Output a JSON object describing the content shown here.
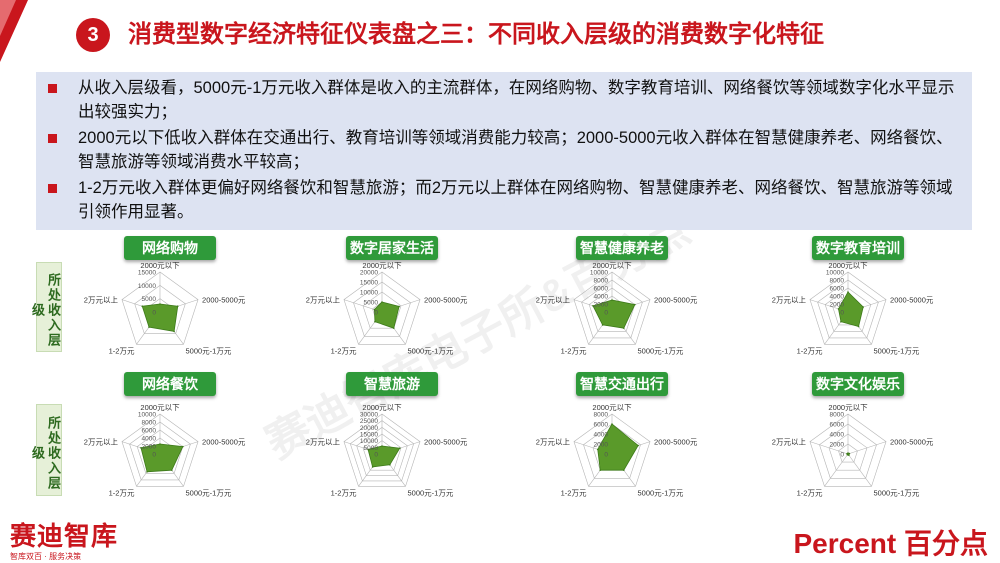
{
  "title": {
    "number": "3",
    "text": "消费型数字经济特征仪表盘之三：不同收入层级的消费数字化特征"
  },
  "bullets": [
    "从收入层级看，5000元-1万元收入群体是收入的主流群体，在网络购物、数字教育培训、网络餐饮等领域数字化水平显示出较强实力；",
    "2000元以下低收入群体在交通出行、教育培训等领域消费能力较高；2000-5000元收入群体在智慧健康养老、网络餐饮、智慧旅游等领域消费水平较高；",
    "1-2万元收入群体更偏好网络餐饮和智慧旅游；而2万元以上群体在网络购物、智慧健康养老、网络餐饮、智慧旅游等领域引领作用显著。"
  ],
  "side_label": "所处收入层级",
  "axes": [
    "2000元以下",
    "2000-5000元",
    "5000元-1万元",
    "1-2万元",
    "2万元以上"
  ],
  "chart_data": [
    {
      "type": "radar",
      "title": "网络购物",
      "ticks": [
        "0",
        "5000",
        "10000",
        "15000"
      ],
      "max": 15000,
      "categories": [
        "2000元以下",
        "2000-5000元",
        "5000元-1万元",
        "1-2万元",
        "2万元以上"
      ],
      "values": [
        3000,
        7000,
        9000,
        7000,
        7000
      ],
      "color": "#5a9a2a"
    },
    {
      "type": "radar",
      "title": "数字居家生活",
      "ticks": [
        "0",
        "5000",
        "10000",
        "15000",
        "20000"
      ],
      "max": 20000,
      "categories": [
        "2000元以下",
        "2000-5000元",
        "5000元-1万元",
        "1-2万元",
        "2万元以上"
      ],
      "values": [
        5000,
        9000,
        10000,
        6000,
        4000
      ],
      "color": "#5a9a2a"
    },
    {
      "type": "radar",
      "title": "智慧健康养老",
      "ticks": [
        "0",
        "2000",
        "4000",
        "6000",
        "8000",
        "10000"
      ],
      "max": 10000,
      "categories": [
        "2000元以下",
        "2000-5000元",
        "5000元-1万元",
        "1-2万元",
        "2万元以上"
      ],
      "values": [
        3000,
        6000,
        5000,
        4000,
        5000
      ],
      "color": "#5a9a2a"
    },
    {
      "type": "radar",
      "title": "数字教育培训",
      "ticks": [
        "0",
        "2000",
        "4000",
        "6000",
        "8000",
        "10000"
      ],
      "max": 10000,
      "categories": [
        "2000元以下",
        "2000-5000元",
        "5000元-1万元",
        "1-2万元",
        "2万元以上"
      ],
      "values": [
        5000,
        4000,
        4500,
        3000,
        2500
      ],
      "color": "#5a9a2a"
    },
    {
      "type": "radar",
      "title": "网络餐饮",
      "ticks": [
        "0",
        "2000",
        "4000",
        "6000",
        "8000",
        "10000"
      ],
      "max": 10000,
      "categories": [
        "2000元以下",
        "2000-5000元",
        "5000元-1万元",
        "1-2万元",
        "2万元以上"
      ],
      "values": [
        2500,
        6000,
        5000,
        5500,
        5000
      ],
      "color": "#5a9a2a"
    },
    {
      "type": "radar",
      "title": "智慧旅游",
      "ticks": [
        "0",
        "5000",
        "10000",
        "15000",
        "20000",
        "25000",
        "30000"
      ],
      "max": 30000,
      "categories": [
        "2000元以下",
        "2000-5000元",
        "5000元-1万元",
        "1-2万元",
        "2万元以上"
      ],
      "values": [
        6000,
        14000,
        10000,
        12000,
        11000
      ],
      "color": "#5a9a2a"
    },
    {
      "type": "radar",
      "title": "智慧交通出行",
      "ticks": [
        "0",
        "2000",
        "4000",
        "6000",
        "8000"
      ],
      "max": 8000,
      "categories": [
        "2000元以下",
        "2000-5000元",
        "5000元-1万元",
        "1-2万元",
        "2万元以上"
      ],
      "values": [
        6000,
        5500,
        4000,
        4000,
        3000
      ],
      "color": "#5a9a2a"
    },
    {
      "type": "radar",
      "title": "数字文化娱乐",
      "ticks": [
        "0",
        "2000",
        "4000",
        "6000",
        "8000"
      ],
      "max": 8000,
      "categories": [
        "2000元以下",
        "2000-5000元",
        "5000元-1万元",
        "1-2万元",
        "2万元以上"
      ],
      "values": [
        200,
        300,
        300,
        200,
        200
      ],
      "color": "#5a9a2a"
    }
  ],
  "footer": {
    "left_logo": "赛迪智库",
    "left_slogan": "智库双百 · 服务决策",
    "right_logo": "Percent 百分点"
  },
  "watermark": "赛迪智库电子所&百分点"
}
